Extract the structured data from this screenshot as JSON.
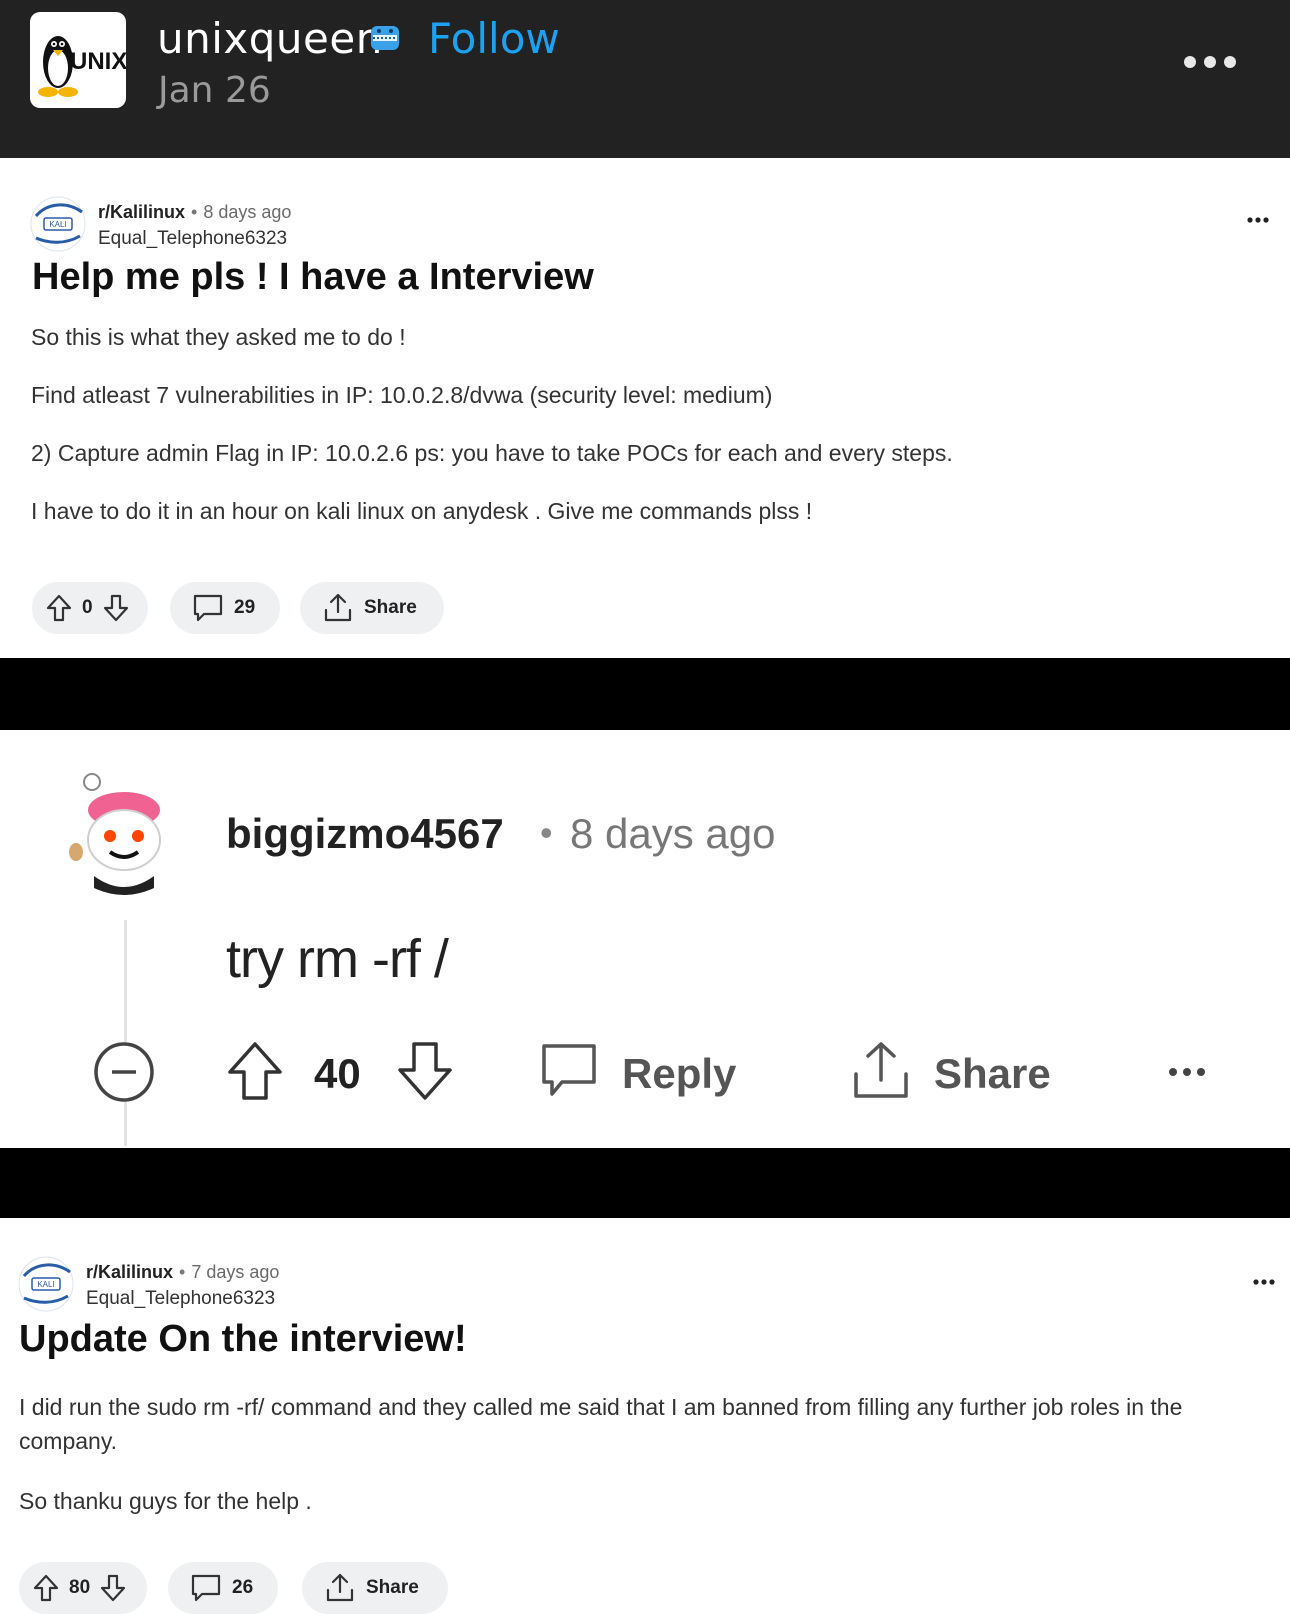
{
  "header": {
    "avatar_text": "UNIX",
    "username": "unixqueen",
    "follow_label": "Follow",
    "date": "Jan 26"
  },
  "post1": {
    "subreddit": "r/Kalilinux",
    "separator": "•",
    "time": "8 days ago",
    "author": "Equal_Telephone6323",
    "title": "Help me pls ! I have a Interview",
    "paragraphs": [
      "So this is what they asked me to do !",
      "Find atleast 7 vulnerabilities in IP: 10.0.2.8/dvwa (security level: medium)",
      "2) Capture admin Flag in IP: 10.0.2.6 ps: you have to take POCs for each and every steps.",
      "I have to do it in an hour on kali linux on anydesk . Give me commands plss !"
    ],
    "votes": "0",
    "comments": "29",
    "share_label": "Share"
  },
  "comment": {
    "user": "biggizmo4567",
    "separator": "•",
    "time": "8 days ago",
    "text": "try rm -rf /",
    "votes": "40",
    "reply_label": "Reply",
    "share_label": "Share"
  },
  "post2": {
    "subreddit": "r/Kalilinux",
    "separator": "•",
    "time": "7 days ago",
    "author": "Equal_Telephone6323",
    "title": "Update On the interview!",
    "paragraphs": [
      "I did run the sudo rm -rf/ command and they called me said that I am banned from filling any further job roles in the company.",
      "So thanku guys for the help ."
    ],
    "votes": "80",
    "comments": "26",
    "share_label": "Share"
  },
  "colors": {
    "header_bg": "#222222",
    "follow": "#1da1f2",
    "band": "#000000",
    "pill_bg": "#eef0f2"
  }
}
